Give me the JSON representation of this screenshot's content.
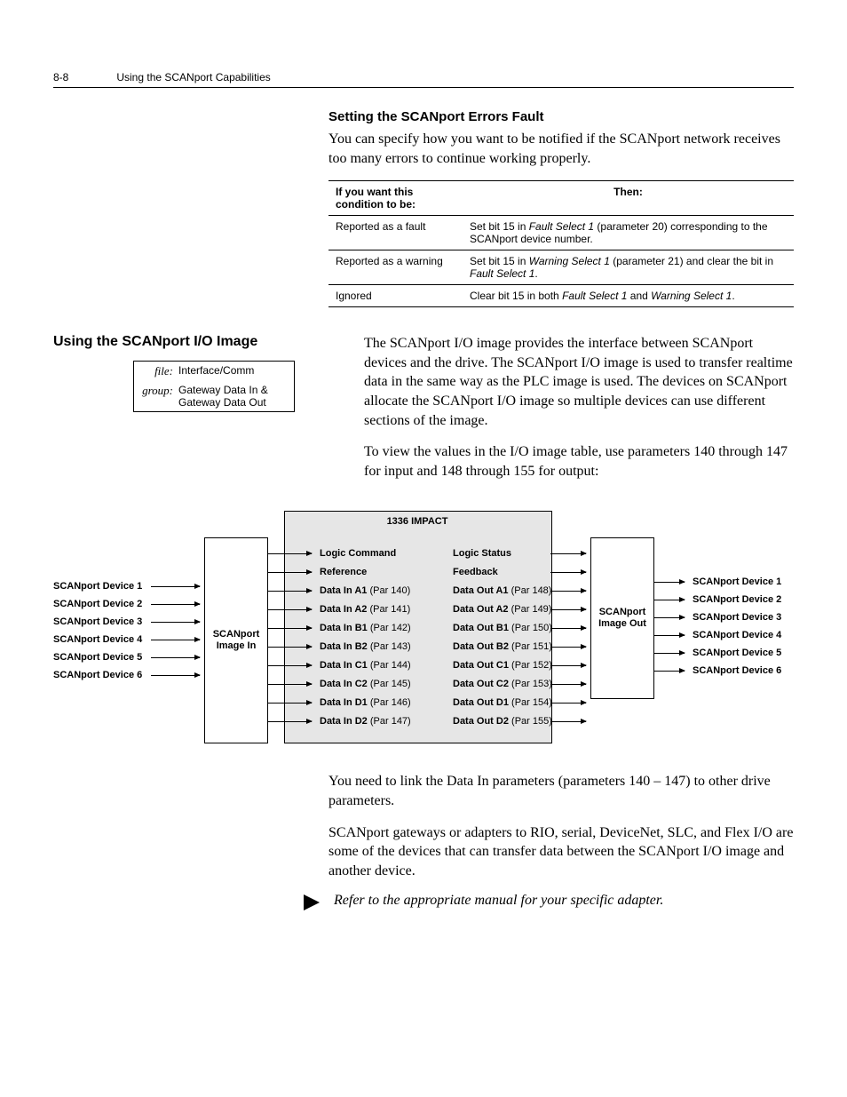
{
  "header": {
    "page_number": "8-8",
    "chapter_title": "Using the SCANport Capabilities"
  },
  "section1": {
    "heading": "Setting the SCANport Errors Fault",
    "p1": "You can specify how you want to be notified if the SCANport network receives too many errors to continue working properly."
  },
  "table1": {
    "head_c1": "If you want this condition to be:",
    "head_c2": "Then:",
    "rows": [
      {
        "c1": "Reported as a fault",
        "c2_pre": "Set bit 15 in ",
        "c2_i1": "Fault Select 1",
        "c2_post": " (parameter 20) corresponding to the SCANport device number."
      },
      {
        "c1": "Reported as a warning",
        "c2_pre": "Set bit 15 in ",
        "c2_i1": "Warning Select 1",
        "c2_mid": " (parameter 21) and clear the bit in ",
        "c2_i2": "Fault Select 1",
        "c2_post": "."
      },
      {
        "c1": "Ignored",
        "c2_pre": "Clear bit 15 in both ",
        "c2_i1": "Fault Select 1",
        "c2_mid": " and ",
        "c2_i2": "Warning Select 1",
        "c2_post": "."
      }
    ]
  },
  "section2": {
    "heading": "Using the SCANport I/O Image",
    "meta_file_label": "file:",
    "meta_file_value": "Interface/Comm",
    "meta_group_label": "group:",
    "meta_group_value": "Gateway Data In & Gateway Data Out",
    "p1": "The SCANport I/O image provides the interface between SCANport devices and the drive. The SCANport I/O image is used to transfer realtime data in the same way as the PLC image is used. The devices on SCANport allocate the SCANport I/O image so multiple devices can use different sections of the image.",
    "p2": "To view the values in the I/O image table, use parameters 140 through 147 for input and 148 through 155 for output:"
  },
  "diagram": {
    "impact_title": "1336 IMPACT",
    "image_in_label": "SCANport Image In",
    "image_out_label": "SCANport Image Out",
    "devices_left": [
      "SCANport Device 1",
      "SCANport Device 2",
      "SCANport Device 3",
      "SCANport Device 4",
      "SCANport Device 5",
      "SCANport Device 6"
    ],
    "devices_right": [
      "SCANport Device 1",
      "SCANport Device 2",
      "SCANport Device 3",
      "SCANport Device 4",
      "SCANport Device 5",
      "SCANport Device 6"
    ],
    "logic_cmd": "Logic Command",
    "reference": "Reference",
    "logic_status": "Logic Status",
    "feedback": "Feedback",
    "data_in": [
      {
        "l": "Data In A1",
        "p": "(Par 140)"
      },
      {
        "l": "Data In A2",
        "p": "(Par 141)"
      },
      {
        "l": "Data In B1",
        "p": "(Par 142)"
      },
      {
        "l": "Data In B2",
        "p": "(Par 143)"
      },
      {
        "l": "Data In C1",
        "p": "(Par 144)"
      },
      {
        "l": "Data In C2",
        "p": "(Par 145)"
      },
      {
        "l": "Data In D1",
        "p": "(Par 146)"
      },
      {
        "l": "Data In D2",
        "p": "(Par 147)"
      }
    ],
    "data_out": [
      {
        "l": "Data Out A1",
        "p": "(Par 148)"
      },
      {
        "l": "Data Out A2",
        "p": "(Par 149)"
      },
      {
        "l": "Data Out B1",
        "p": "(Par 150)"
      },
      {
        "l": "Data Out B2",
        "p": "(Par 151)"
      },
      {
        "l": "Data Out C1",
        "p": "(Par 152)"
      },
      {
        "l": "Data Out C2",
        "p": "(Par 153)"
      },
      {
        "l": "Data Out D1",
        "p": "(Par 154)"
      },
      {
        "l": "Data Out D2",
        "p": "(Par 155)"
      }
    ]
  },
  "after_diagram": {
    "p1": "You need to link the Data In parameters (parameters 140 – 147) to other drive parameters.",
    "p2": "SCANport gateways or adapters to RIO, serial, DeviceNet, SLC, and Flex I/O are some of the devices that can transfer data between the SCANport I/O image and another device.",
    "note": "Refer to the appropriate manual for your specific adapter."
  }
}
